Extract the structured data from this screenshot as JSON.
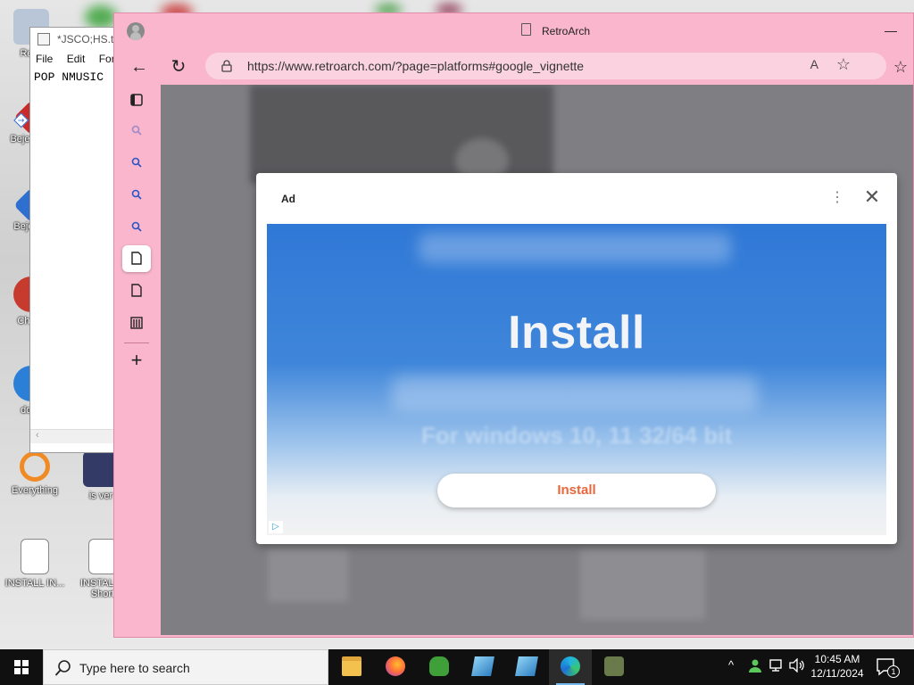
{
  "desktop": {
    "icons": [
      {
        "label": "Recy",
        "color": "#9fb7d6"
      },
      {
        "label": "Bejew De",
        "color": "#c92b2b"
      },
      {
        "label": "Beje De",
        "color": "#2f6fd0"
      },
      {
        "label": "Ch De",
        "color": "#c73a2e"
      },
      {
        "label": "does",
        "color": "#2b7fd6"
      },
      {
        "label": "Everything",
        "color": "#f08a24"
      },
      {
        "label": "is ver",
        "color": "#333a66"
      },
      {
        "label": "INSTALL IN...",
        "color": "#ffffff"
      },
      {
        "label": "INSTALL - Short",
        "color": "#ffffff"
      }
    ]
  },
  "notepad": {
    "title": "*JSCO;HS.txt",
    "menu": [
      "File",
      "Edit",
      "Form"
    ],
    "content": "POP NMUSIC"
  },
  "browser": {
    "tab_title": "RetroArch",
    "minimize_glyph": "—",
    "back_glyph": "←",
    "refresh_glyph": "↻",
    "url": "https://www.retroarch.com/?page=platforms#google_vignette",
    "read_aloud_glyph": "A",
    "fav_glyph": "☆",
    "favorites_glyph": "☆",
    "sidebar": {
      "add_glyph": "+"
    }
  },
  "ad": {
    "label": "Ad",
    "menu_glyph": "⋮",
    "close_glyph": "✕",
    "headline": "Install",
    "subtext": "For windows 10, 11 32/64 bit",
    "button_label": "Install",
    "adchoices_glyph": "▷"
  },
  "taskbar": {
    "search_placeholder": "Type here to search",
    "time": "10:45 AM",
    "date": "12/11/2024",
    "notification_count": "1",
    "tray_chevron": "^",
    "colors": {
      "background": "#101010",
      "accent": "#76b9ed"
    }
  }
}
